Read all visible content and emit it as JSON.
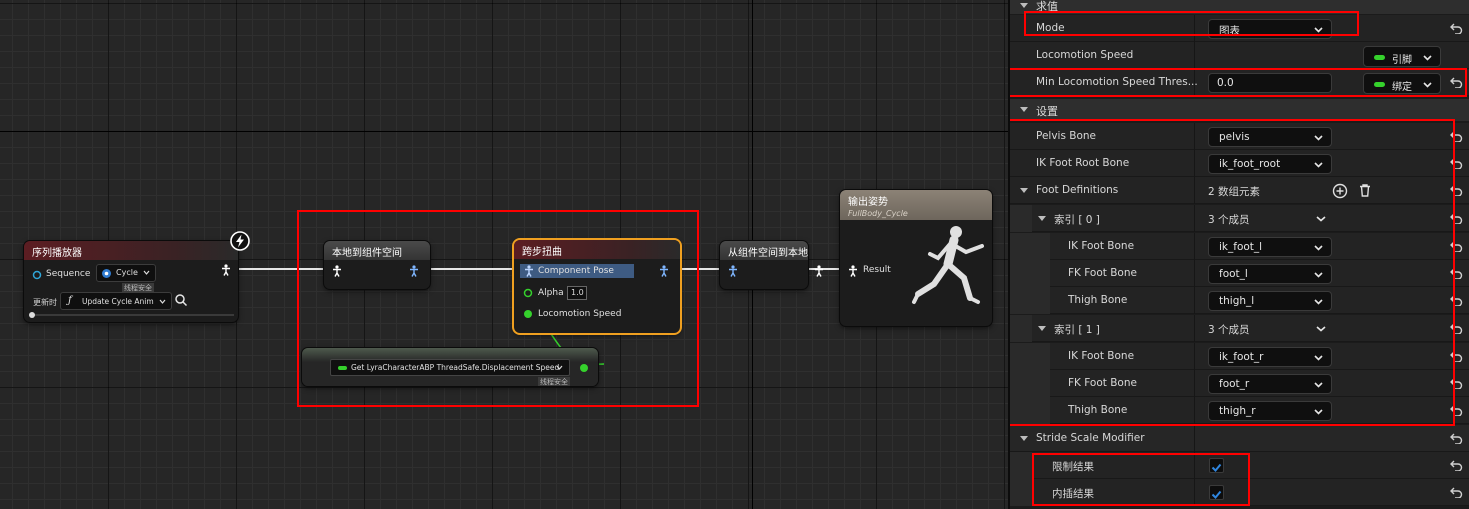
{
  "graph": {
    "sequence_node": {
      "title": "序列播放器",
      "pin_label": "Sequence",
      "sequence_value": "Cycle",
      "thread_safe_tag": "线程安全",
      "update_label": "更新时",
      "update_function": "Update Cycle Anim"
    },
    "local_to_component_node": {
      "title": "本地到组件空间"
    },
    "stride_warp_node": {
      "title": "跨步扭曲",
      "pin_component_pose": "Component Pose",
      "pin_alpha": "Alpha",
      "alpha_value": "1.0",
      "pin_locomotion_speed": "Locomotion Speed"
    },
    "component_to_local_node": {
      "title": "从组件空间到本地"
    },
    "output_pose_node": {
      "title": "输出姿势",
      "subtitle": "FullBody_Cycle",
      "pin_result": "Result"
    },
    "getter_node": {
      "label": "Get LyraCharacterABP ThreadSafe.Displacement Speed",
      "thread_safe_tag": "线程安全"
    },
    "colors": {
      "highlight_box": "#ff0000",
      "selected_node_border": "#f0a020",
      "float_pin": "#35d12c",
      "pose_pin": "#7fb6ff"
    }
  },
  "panel": {
    "top_category": "求值",
    "mode": {
      "label": "Mode",
      "value": "图表"
    },
    "locomotion_speed": {
      "label": "Locomotion Speed",
      "binding": "引脚"
    },
    "min_threshold": {
      "label": "Min Locomotion Speed Thres...",
      "value": "0.0",
      "binding": "绑定"
    },
    "settings_category": "设置",
    "pelvis_bone": {
      "label": "Pelvis Bone",
      "value": "pelvis"
    },
    "ik_foot_root_bone": {
      "label": "IK Foot Root Bone",
      "value": "ik_foot_root"
    },
    "foot_definitions": {
      "label": "Foot Definitions",
      "value": "2 数组元素"
    },
    "index0": {
      "label": "索引 [ 0 ]",
      "value": "3 个成员",
      "ik_foot_bone": {
        "label": "IK Foot Bone",
        "value": "ik_foot_l"
      },
      "fk_foot_bone": {
        "label": "FK Foot Bone",
        "value": "foot_l"
      },
      "thigh_bone": {
        "label": "Thigh Bone",
        "value": "thigh_l"
      }
    },
    "index1": {
      "label": "索引 [ 1 ]",
      "value": "3 个成员",
      "ik_foot_bone": {
        "label": "IK Foot Bone",
        "value": "ik_foot_r"
      },
      "fk_foot_bone": {
        "label": "FK Foot Bone",
        "value": "foot_r"
      },
      "thigh_bone": {
        "label": "Thigh Bone",
        "value": "thigh_r"
      }
    },
    "stride_scale_modifier": "Stride Scale Modifier",
    "clamp_result": {
      "label": "限制结果",
      "checked": true
    },
    "interp_result": {
      "label": "内插结果",
      "checked": true
    }
  }
}
